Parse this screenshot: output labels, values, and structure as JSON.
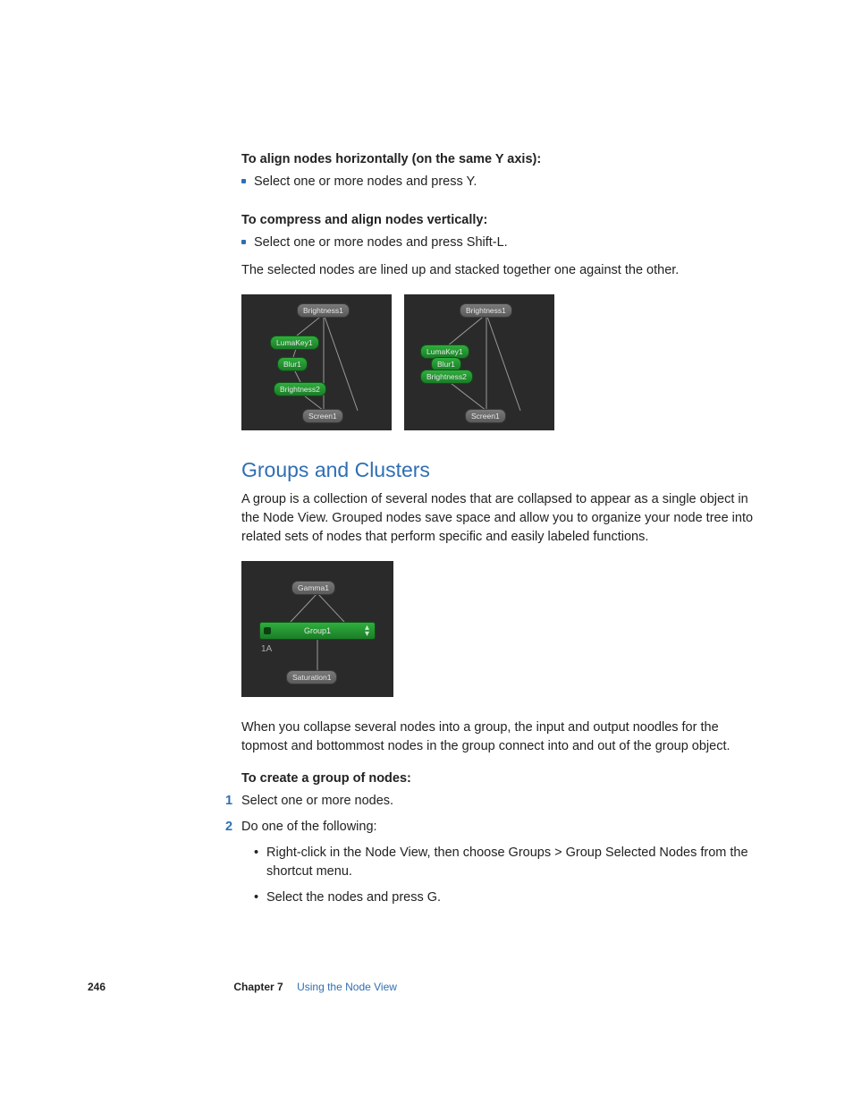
{
  "sections": {
    "alignH": {
      "heading": "To align nodes horizontally (on the same Y axis):",
      "bullet": "Select one or more nodes and press Y."
    },
    "compressV": {
      "heading": "To compress and align nodes vertically:",
      "bullet": "Select one or more nodes and press Shift-L.",
      "after": "The selected nodes are lined up and stacked together one against the other."
    },
    "diagram1": {
      "n1": "Brightness1",
      "n2": "LumaKey1",
      "n3": "Blur1",
      "n4": "Brightness2",
      "n5": "Screen1"
    },
    "diagram2": {
      "n1": "Brightness1",
      "n2": "LumaKey1",
      "n3": "Blur1",
      "n4": "Brightness2",
      "n5": "Screen1"
    },
    "groups": {
      "title": "Groups and Clusters",
      "p1": "A group is a collection of several nodes that are collapsed to appear as a single object in the Node View. Grouped nodes save space and allow you to organize your node tree into related sets of nodes that perform specific and easily labeled functions.",
      "diag": {
        "top": "Gamma1",
        "mid": "Group1",
        "label": "1A",
        "bot": "Saturation1"
      },
      "p2": "When you collapse several nodes into a group, the input and output noodles for the topmost and bottommost nodes in the group connect into and out of the group object.",
      "createHeading": "To create a group of nodes:",
      "step1": "Select one or more nodes.",
      "step2": "Do one of the following:",
      "sub1": "Right-click in the Node View, then choose Groups > Group Selected Nodes from the shortcut menu.",
      "sub2": "Select the nodes and press G."
    }
  },
  "footer": {
    "page": "246",
    "chapter": "Chapter 7",
    "title": "Using the Node View"
  }
}
